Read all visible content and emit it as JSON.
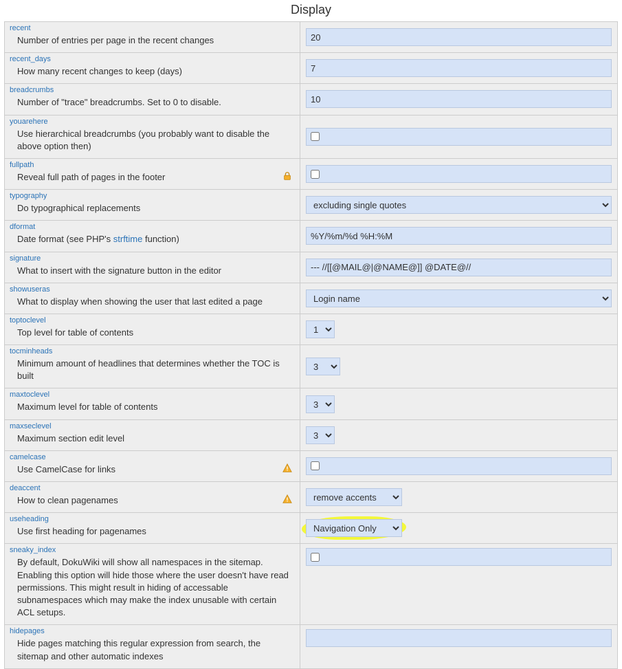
{
  "section_title": "Display",
  "rows": {
    "recent": {
      "key": "recent",
      "label": "Number of entries per page in the recent changes",
      "value": "20"
    },
    "recent_days": {
      "key": "recent_days",
      "label": "How many recent changes to keep (days)",
      "value": "7"
    },
    "breadcrumbs": {
      "key": "breadcrumbs",
      "label": "Number of \"trace\" breadcrumbs. Set to 0 to disable.",
      "value": "10"
    },
    "youarehere": {
      "key": "youarehere",
      "label": "Use hierarchical breadcrumbs (you probably want to disable the above option then)"
    },
    "fullpath": {
      "key": "fullpath",
      "label": "Reveal full path of pages in the footer"
    },
    "typography": {
      "key": "typography",
      "label": "Do typographical replacements",
      "value": "excluding single quotes"
    },
    "dformat": {
      "key": "dformat",
      "prefix": "Date format (see PHP's ",
      "link": "strftime",
      "suffix": " function)",
      "value": "%Y/%m/%d %H:%M"
    },
    "signature": {
      "key": "signature",
      "label": "What to insert with the signature button in the editor",
      "value": "--- //[[@MAIL@|@NAME@]] @DATE@//"
    },
    "showuseras": {
      "key": "showuseras",
      "label": "What to display when showing the user that last edited a page",
      "value": "Login name"
    },
    "toptoclevel": {
      "key": "toptoclevel",
      "label": "Top level for table of contents",
      "value": "1"
    },
    "tocminheads": {
      "key": "tocminheads",
      "label": "Minimum amount of headlines that determines whether the TOC is built",
      "value": "3"
    },
    "maxtoclevel": {
      "key": "maxtoclevel",
      "label": "Maximum level for table of contents",
      "value": "3"
    },
    "maxseclevel": {
      "key": "maxseclevel",
      "label": "Maximum section edit level",
      "value": "3"
    },
    "camelcase": {
      "key": "camelcase",
      "label": "Use CamelCase for links"
    },
    "deaccent": {
      "key": "deaccent",
      "label": "How to clean pagenames",
      "value": "remove accents"
    },
    "useheading": {
      "key": "useheading",
      "label": "Use first heading for pagenames",
      "value": "Navigation Only"
    },
    "sneaky_index": {
      "key": "sneaky_index",
      "label": "By default, DokuWiki will show all namespaces in the sitemap. Enabling this option will hide those where the user doesn't have read permissions. This might result in hiding of accessable subnamespaces which may make the index unusable with certain ACL setups."
    },
    "hidepages": {
      "key": "hidepages",
      "label": "Hide pages matching this regular expression from search, the sitemap and other automatic indexes",
      "value": ""
    }
  }
}
